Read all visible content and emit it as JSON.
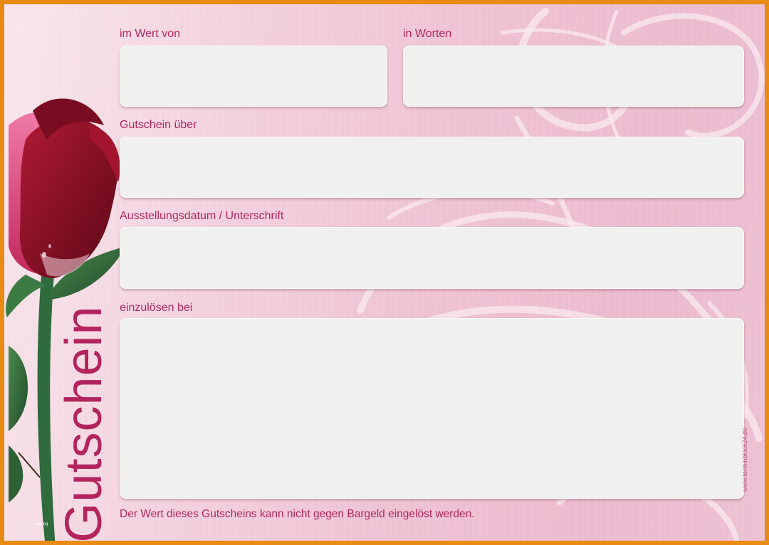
{
  "colors": {
    "border": "#e98a12",
    "accent_text": "#b2275e",
    "field_fill": "#f0f1ee",
    "rose_red": "#8f1027",
    "stem_green": "#2f6b3d"
  },
  "voucher": {
    "title": "Gutschein",
    "fields": {
      "value_label": "im Wert von",
      "words_label": "in Worten",
      "subject_label": "Gutschein über",
      "date_signature_label": "Ausstellungsdatum / Unterschrift",
      "redeem_label": "einzulösen bei"
    },
    "footer_note": "Der Wert dieses Gutscheins kann nicht gegen Bargeld eingelöst werden.",
    "website": "www.terminblock24.de",
    "watermark": "katalog"
  },
  "icons": {
    "rose": "rose-illustration",
    "swirls": "ribbon-swirl-decoration"
  }
}
